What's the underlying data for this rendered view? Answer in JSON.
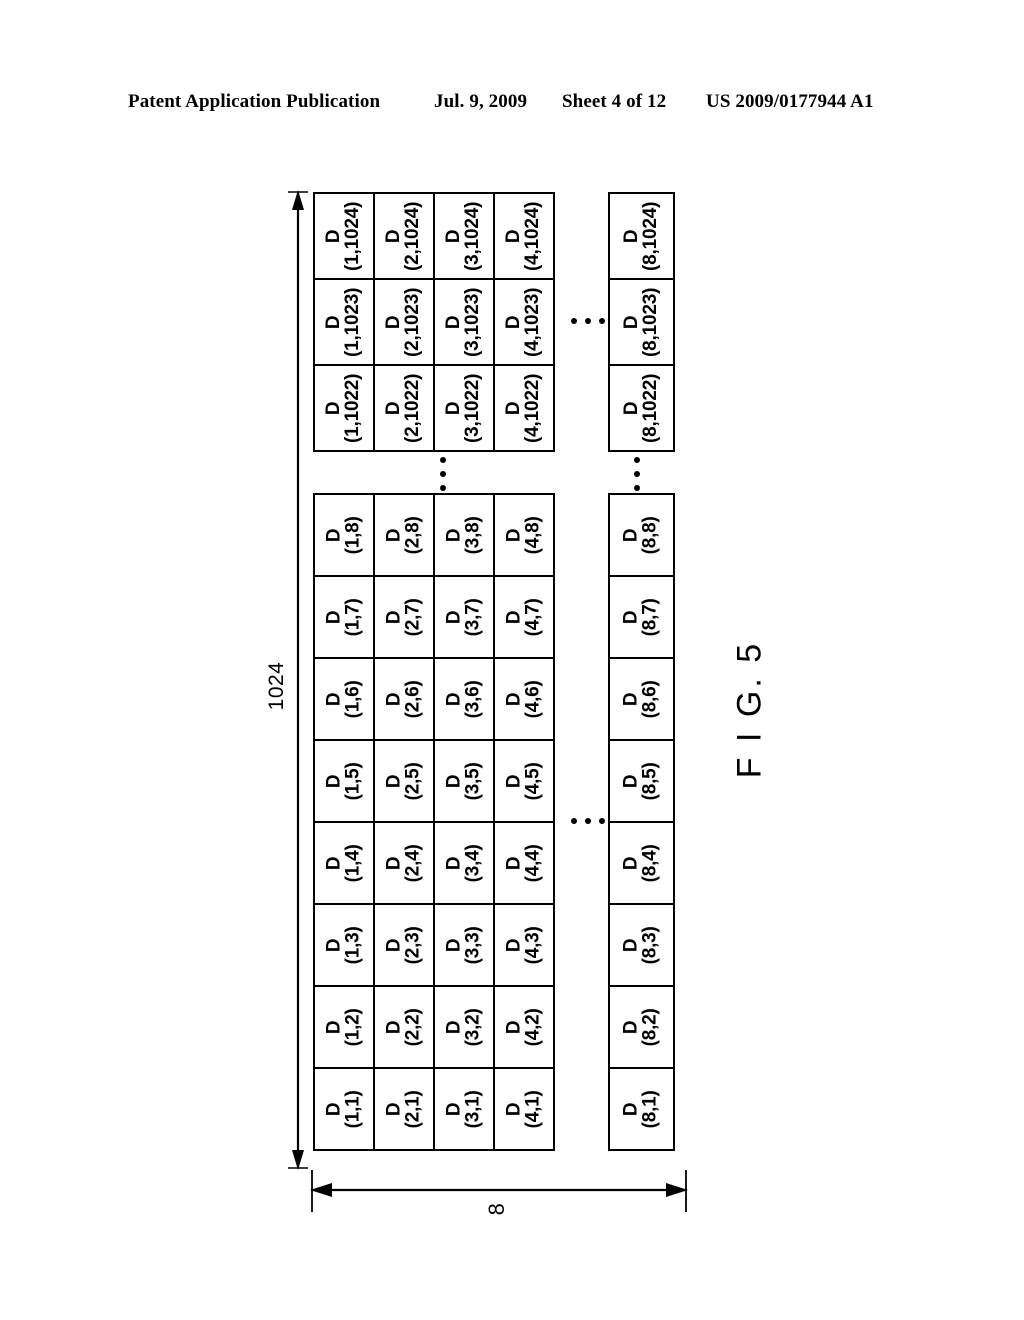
{
  "header": {
    "publication": "Patent Application Publication",
    "date": "Jul. 9, 2009",
    "sheet": "Sheet 4 of 12",
    "patent_number": "US 2009/0177944 A1"
  },
  "figure": {
    "caption": "F I G. 5",
    "vertical_dimension_label": "1024",
    "horizontal_dimension_label": "8",
    "cell_prefix": "D",
    "top_block": {
      "rows": [
        {
          "row_index": 1024,
          "cells": [
            {
              "prefix": "D",
              "coords": "(1,1024)"
            },
            {
              "prefix": "D",
              "coords": "(2,1024)"
            },
            {
              "prefix": "D",
              "coords": "(3,1024)"
            },
            {
              "prefix": "D",
              "coords": "(4,1024)"
            }
          ],
          "eight_cell": {
            "prefix": "D",
            "coords": "(8,1024)"
          }
        },
        {
          "row_index": 1023,
          "cells": [
            {
              "prefix": "D",
              "coords": "(1,1023)"
            },
            {
              "prefix": "D",
              "coords": "(2,1023)"
            },
            {
              "prefix": "D",
              "coords": "(3,1023)"
            },
            {
              "prefix": "D",
              "coords": "(4,1023)"
            }
          ],
          "eight_cell": {
            "prefix": "D",
            "coords": "(8,1023)"
          }
        },
        {
          "row_index": 1022,
          "cells": [
            {
              "prefix": "D",
              "coords": "(1,1022)"
            },
            {
              "prefix": "D",
              "coords": "(2,1022)"
            },
            {
              "prefix": "D",
              "coords": "(3,1022)"
            },
            {
              "prefix": "D",
              "coords": "(4,1022)"
            }
          ],
          "eight_cell": {
            "prefix": "D",
            "coords": "(8,1022)"
          }
        }
      ]
    },
    "bottom_block": {
      "rows": [
        {
          "row_index": 8,
          "cells": [
            {
              "prefix": "D",
              "coords": "(1,8)"
            },
            {
              "prefix": "D",
              "coords": "(2,8)"
            },
            {
              "prefix": "D",
              "coords": "(3,8)"
            },
            {
              "prefix": "D",
              "coords": "(4,8)"
            }
          ],
          "eight_cell": {
            "prefix": "D",
            "coords": "(8,8)"
          }
        },
        {
          "row_index": 7,
          "cells": [
            {
              "prefix": "D",
              "coords": "(1,7)"
            },
            {
              "prefix": "D",
              "coords": "(2,7)"
            },
            {
              "prefix": "D",
              "coords": "(3,7)"
            },
            {
              "prefix": "D",
              "coords": "(4,7)"
            }
          ],
          "eight_cell": {
            "prefix": "D",
            "coords": "(8,7)"
          }
        },
        {
          "row_index": 6,
          "cells": [
            {
              "prefix": "D",
              "coords": "(1,6)"
            },
            {
              "prefix": "D",
              "coords": "(2,6)"
            },
            {
              "prefix": "D",
              "coords": "(3,6)"
            },
            {
              "prefix": "D",
              "coords": "(4,6)"
            }
          ],
          "eight_cell": {
            "prefix": "D",
            "coords": "(8,6)"
          }
        },
        {
          "row_index": 5,
          "cells": [
            {
              "prefix": "D",
              "coords": "(1,5)"
            },
            {
              "prefix": "D",
              "coords": "(2,5)"
            },
            {
              "prefix": "D",
              "coords": "(3,5)"
            },
            {
              "prefix": "D",
              "coords": "(4,5)"
            }
          ],
          "eight_cell": {
            "prefix": "D",
            "coords": "(8,5)"
          }
        },
        {
          "row_index": 4,
          "cells": [
            {
              "prefix": "D",
              "coords": "(1,4)"
            },
            {
              "prefix": "D",
              "coords": "(2,4)"
            },
            {
              "prefix": "D",
              "coords": "(3,4)"
            },
            {
              "prefix": "D",
              "coords": "(4,4)"
            }
          ],
          "eight_cell": {
            "prefix": "D",
            "coords": "(8,4)"
          }
        },
        {
          "row_index": 3,
          "cells": [
            {
              "prefix": "D",
              "coords": "(1,3)"
            },
            {
              "prefix": "D",
              "coords": "(2,3)"
            },
            {
              "prefix": "D",
              "coords": "(3,3)"
            },
            {
              "prefix": "D",
              "coords": "(4,3)"
            }
          ],
          "eight_cell": {
            "prefix": "D",
            "coords": "(8,3)"
          }
        },
        {
          "row_index": 2,
          "cells": [
            {
              "prefix": "D",
              "coords": "(1,2)"
            },
            {
              "prefix": "D",
              "coords": "(2,2)"
            },
            {
              "prefix": "D",
              "coords": "(3,2)"
            },
            {
              "prefix": "D",
              "coords": "(4,2)"
            }
          ],
          "eight_cell": {
            "prefix": "D",
            "coords": "(8,2)"
          }
        },
        {
          "row_index": 1,
          "cells": [
            {
              "prefix": "D",
              "coords": "(1,1)"
            },
            {
              "prefix": "D",
              "coords": "(2,1)"
            },
            {
              "prefix": "D",
              "coords": "(3,1)"
            },
            {
              "prefix": "D",
              "coords": "(4,1)"
            }
          ],
          "eight_cell": {
            "prefix": "D",
            "coords": "(8,1)"
          }
        }
      ]
    }
  },
  "colors": {
    "ink": "#000000",
    "paper": "#ffffff"
  }
}
